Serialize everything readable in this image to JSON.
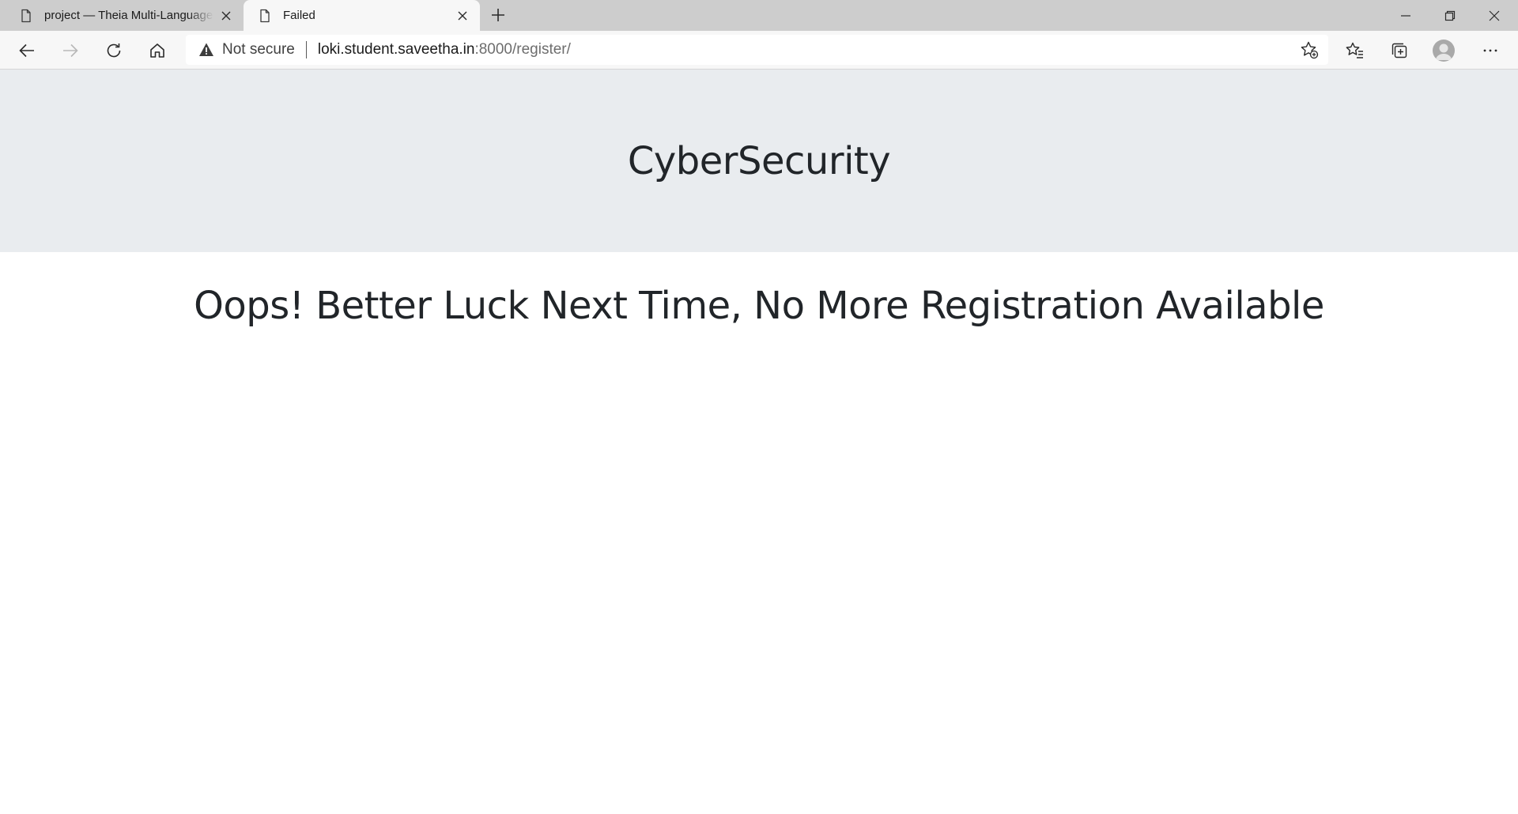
{
  "browser": {
    "tabs": [
      {
        "title": "project — Theia Multi-Language",
        "active": false
      },
      {
        "title": "Failed",
        "active": true
      }
    ],
    "address_bar": {
      "security_label": "Not secure",
      "url_host": "loki.student.saveetha.in",
      "url_rest": ":8000/register/"
    },
    "icons": {
      "tab": "page-icon",
      "close": "close-icon",
      "new_tab": "plus-icon",
      "back": "back-arrow-icon",
      "forward": "forward-arrow-icon",
      "refresh": "refresh-icon",
      "home": "home-icon",
      "warning": "warning-icon",
      "add_favorite": "add-favorite-icon",
      "favorites": "favorites-icon",
      "collections": "collections-icon",
      "profile": "profile-avatar",
      "menu": "more-icon"
    }
  },
  "page": {
    "header_title": "CyberSecurity",
    "message": "Oops! Better Luck Next Time, No More Registration Available"
  },
  "colors": {
    "header_background": "#e9ecef",
    "text": "#212529",
    "tab_strip": "#cdcdcd",
    "toolbar": "#f7f7f7"
  }
}
